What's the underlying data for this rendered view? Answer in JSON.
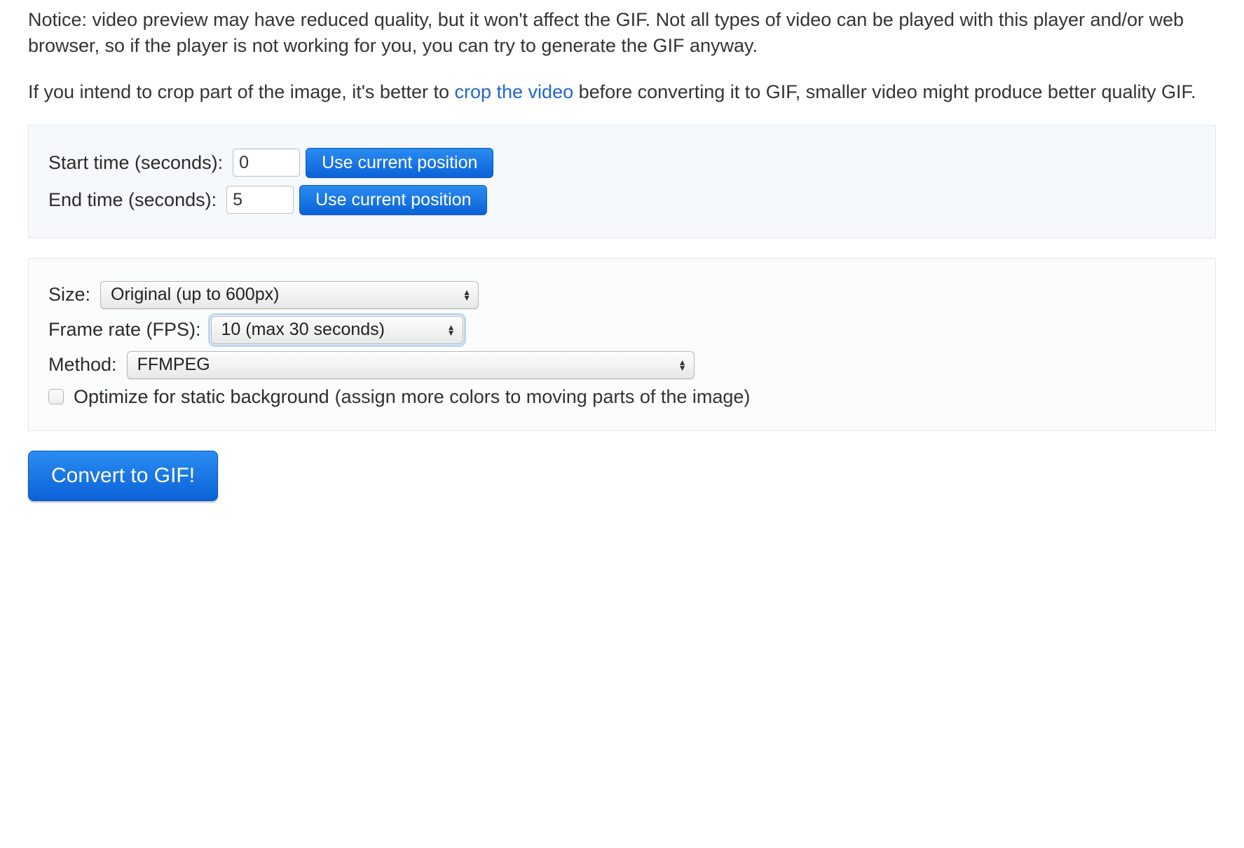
{
  "notice": {
    "p1": "Notice: video preview may have reduced quality, but it won't affect the GIF. Not all types of video can be played with this player and/or web browser, so if the player is not working for you, you can try to generate the GIF anyway.",
    "p2_pre": "If you intend to crop part of the image, it's better to ",
    "p2_link": "crop the video",
    "p2_post": " before converting it to GIF, smaller video might produce better quality GIF."
  },
  "time_panel": {
    "start_label": "Start time (seconds):",
    "start_value": "0",
    "start_btn": "Use current position",
    "end_label": "End time (seconds):",
    "end_value": "5",
    "end_btn": "Use current position"
  },
  "options_panel": {
    "size_label": "Size:",
    "size_value": "Original (up to 600px)",
    "fps_label": "Frame rate (FPS):",
    "fps_value": "10 (max 30 seconds)",
    "method_label": "Method:",
    "method_value": "FFMPEG",
    "optimize_label": "Optimize for static background",
    "optimize_hint": " (assign more colors to moving parts of the image)"
  },
  "convert_btn": "Convert to GIF!"
}
